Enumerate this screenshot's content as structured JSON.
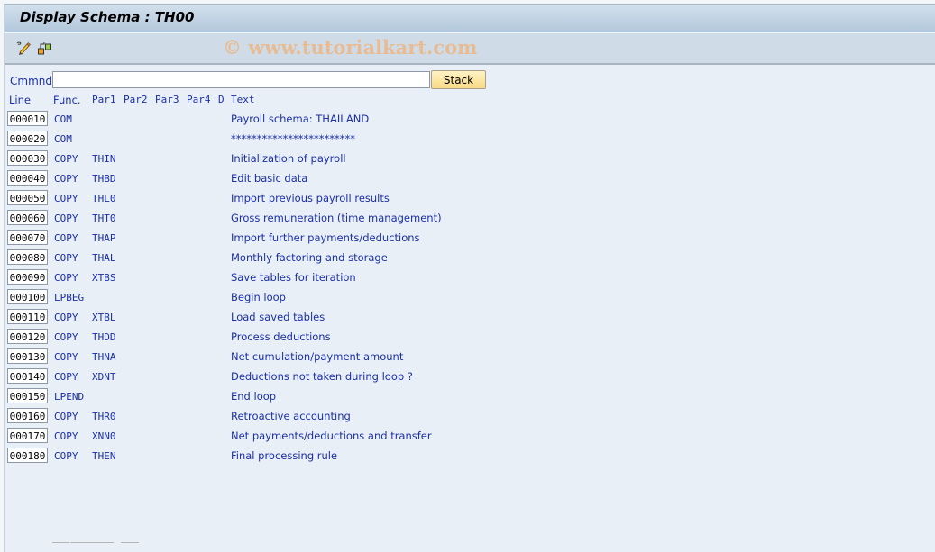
{
  "window": {
    "title": "Display Schema : TH00",
    "watermark": "© www.tutorialkart.com"
  },
  "toolbar": {
    "icons": [
      {
        "name": "change-display-icon",
        "label": "Display/Change"
      },
      {
        "name": "hierarchy-icon",
        "label": "Structure"
      }
    ]
  },
  "command": {
    "label": "Cmmnd",
    "value": "",
    "placeholder": "",
    "stack_label": "Stack"
  },
  "columns": {
    "line": "Line",
    "func": "Func.",
    "par1": "Par1",
    "par2": "Par2",
    "par3": "Par3",
    "par4": "Par4",
    "d": "D",
    "text": "Text"
  },
  "rows": [
    {
      "line": "000010",
      "func": "COM",
      "par1": "",
      "text": "Payroll schema: THAILAND"
    },
    {
      "line": "000020",
      "func": "COM",
      "par1": "",
      "text": "************************"
    },
    {
      "line": "000030",
      "func": "COPY",
      "par1": "THIN",
      "text": "Initialization of payroll"
    },
    {
      "line": "000040",
      "func": "COPY",
      "par1": "THBD",
      "text": "Edit basic data"
    },
    {
      "line": "000050",
      "func": "COPY",
      "par1": "THL0",
      "text": "Import previous payroll results"
    },
    {
      "line": "000060",
      "func": "COPY",
      "par1": "THT0",
      "text": "Gross remuneration (time management)"
    },
    {
      "line": "000070",
      "func": "COPY",
      "par1": "THAP",
      "text": "Import further payments/deductions"
    },
    {
      "line": "000080",
      "func": "COPY",
      "par1": "THAL",
      "text": "Monthly factoring and storage"
    },
    {
      "line": "000090",
      "func": "COPY",
      "par1": "XTBS",
      "text": "Save tables for iteration"
    },
    {
      "line": "000100",
      "func": "LPBEG",
      "par1": "",
      "text": "Begin loop"
    },
    {
      "line": "000110",
      "func": "COPY",
      "par1": "XTBL",
      "text": "Load saved tables"
    },
    {
      "line": "000120",
      "func": "COPY",
      "par1": "THDD",
      "text": "Process deductions"
    },
    {
      "line": "000130",
      "func": "COPY",
      "par1": "THNA",
      "text": "Net cumulation/payment amount"
    },
    {
      "line": "000140",
      "func": "COPY",
      "par1": "XDNT",
      "text": "Deductions not taken during loop ?"
    },
    {
      "line": "000150",
      "func": "LPEND",
      "par1": "",
      "text": "End loop"
    },
    {
      "line": "000160",
      "func": "COPY",
      "par1": "THR0",
      "text": "Retroactive accounting"
    },
    {
      "line": "000170",
      "func": "COPY",
      "par1": "XNN0",
      "text": "Net payments/deductions and transfer"
    },
    {
      "line": "000180",
      "func": "COPY",
      "par1": "THEN",
      "text": "Final processing rule"
    }
  ]
}
